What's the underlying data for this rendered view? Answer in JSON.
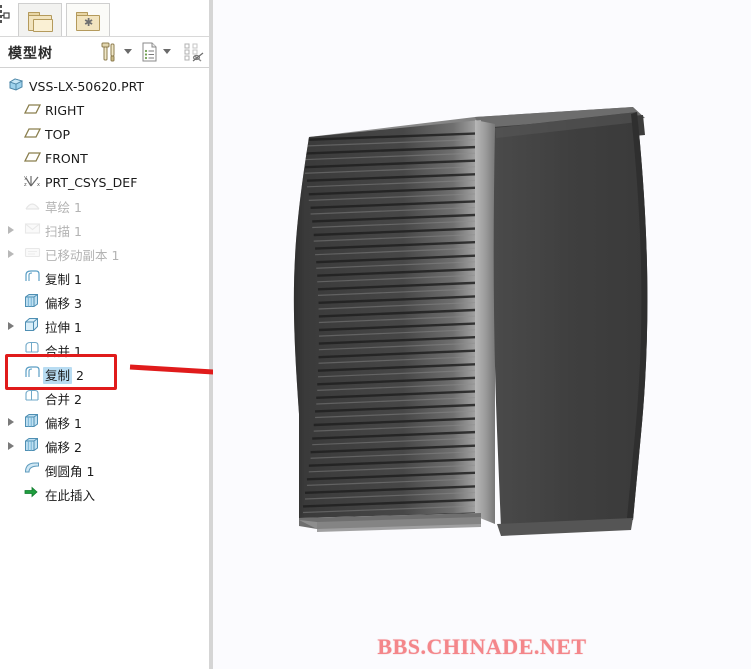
{
  "window": {
    "app_hint": "CAD model tree panel"
  },
  "tabs": [
    {
      "name": "folders-tab",
      "icon": "folders-icon",
      "label": ""
    },
    {
      "name": "favorites-tab",
      "icon": "folder-star-icon",
      "label": ""
    }
  ],
  "header": {
    "title": "模型树",
    "buttons": [
      {
        "name": "settings-tools-button",
        "icon": "hammer-screwdriver-icon",
        "label": ""
      },
      {
        "name": "tools-dropdown-button",
        "icon": "chevron-down-icon",
        "label": ""
      },
      {
        "name": "tree-columns-button",
        "icon": "list-document-icon",
        "label": ""
      },
      {
        "name": "columns-dropdown-button",
        "icon": "chevron-down-icon",
        "label": ""
      },
      {
        "name": "tree-filters-button",
        "icon": "filter-off-icon",
        "label": ""
      }
    ]
  },
  "tree": {
    "items": [
      {
        "label": "VSS-LX-50620.PRT",
        "num": "",
        "icon": "part-icon",
        "indent": 0,
        "arrow": false,
        "dim": false,
        "selected": false
      },
      {
        "label": "RIGHT",
        "num": "",
        "icon": "datum-plane-icon",
        "indent": 1,
        "arrow": false,
        "dim": false,
        "selected": false
      },
      {
        "label": "TOP",
        "num": "",
        "icon": "datum-plane-icon",
        "indent": 1,
        "arrow": false,
        "dim": false,
        "selected": false
      },
      {
        "label": "FRONT",
        "num": "",
        "icon": "datum-plane-icon",
        "indent": 1,
        "arrow": false,
        "dim": false,
        "selected": false
      },
      {
        "label": "PRT_CSYS_DEF",
        "num": "",
        "icon": "csys-icon",
        "indent": 1,
        "arrow": false,
        "dim": false,
        "selected": false
      },
      {
        "label": "草绘",
        "num": "1",
        "icon": "sketch-icon",
        "indent": 1,
        "arrow": false,
        "dim": true,
        "selected": false
      },
      {
        "label": "扫描",
        "num": "1",
        "icon": "sweep-icon",
        "indent": 1,
        "arrow": true,
        "dim": true,
        "selected": false
      },
      {
        "label": "已移动副本",
        "num": "1",
        "icon": "moved-copy-icon",
        "indent": 1,
        "arrow": true,
        "dim": true,
        "selected": false
      },
      {
        "label": "复制",
        "num": "1",
        "icon": "copy-icon",
        "indent": 1,
        "arrow": false,
        "dim": false,
        "selected": false
      },
      {
        "label": "偏移",
        "num": "3",
        "icon": "offset-icon",
        "indent": 1,
        "arrow": false,
        "dim": false,
        "selected": false
      },
      {
        "label": "拉伸",
        "num": "1",
        "icon": "extrude-icon",
        "indent": 1,
        "arrow": true,
        "dim": false,
        "selected": false
      },
      {
        "label": "合并",
        "num": "1",
        "icon": "merge-icon",
        "indent": 1,
        "arrow": false,
        "dim": false,
        "selected": false
      },
      {
        "label": "复制",
        "num": "2",
        "icon": "copy-icon",
        "indent": 1,
        "arrow": false,
        "dim": false,
        "selected": true
      },
      {
        "label": "合并",
        "num": "2",
        "icon": "merge-icon",
        "indent": 1,
        "arrow": false,
        "dim": false,
        "selected": false
      },
      {
        "label": "偏移",
        "num": "1",
        "icon": "offset-icon",
        "indent": 1,
        "arrow": true,
        "dim": false,
        "selected": false
      },
      {
        "label": "偏移",
        "num": "2",
        "icon": "offset-icon",
        "indent": 1,
        "arrow": true,
        "dim": false,
        "selected": false
      },
      {
        "label": "倒圆角",
        "num": "1",
        "icon": "round-icon",
        "indent": 1,
        "arrow": false,
        "dim": false,
        "selected": false
      },
      {
        "label": "在此插入",
        "num": "",
        "icon": "insert-here-icon",
        "indent": 1,
        "arrow": false,
        "dim": false,
        "selected": false
      }
    ]
  },
  "annotations": {
    "highlight_rect": {
      "name": "red-highlight-rectangle",
      "color": "#e01b1b",
      "target": "复制 2"
    },
    "arrow": {
      "name": "red-pointer-arrow",
      "color": "#e01b1b",
      "direction": "right"
    }
  },
  "viewport": {
    "background": "#fbfbfe",
    "model_name": "ribbed hourglass extrusion",
    "watermark": "BBS.CHINADE.NET",
    "watermark_color": "#f4868a"
  },
  "colors": {
    "selection_highlight": "#b8dcf2",
    "panel_border": "#c9c9c9",
    "text": "#1b1b1b",
    "dim_text": "#b3b3b3"
  }
}
